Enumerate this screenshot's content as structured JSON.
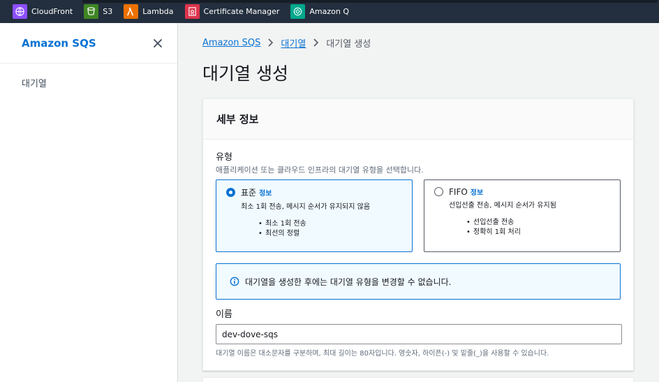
{
  "topbar": {
    "services": [
      {
        "label": "CloudFront",
        "icon": "cloudfront-icon",
        "color": "#8c4fff"
      },
      {
        "label": "S3",
        "icon": "s3-icon",
        "color": "#3f8624"
      },
      {
        "label": "Lambda",
        "icon": "lambda-icon",
        "color": "#ed7100"
      },
      {
        "label": "Certificate Manager",
        "icon": "certificate-manager-icon",
        "color": "#dd344c"
      },
      {
        "label": "Amazon Q",
        "icon": "amazon-q-icon",
        "color": "#01a88d"
      }
    ]
  },
  "sidenav": {
    "title": "Amazon SQS",
    "items": [
      {
        "label": "대기열"
      }
    ]
  },
  "breadcrumb": {
    "items": [
      {
        "label": "Amazon SQS"
      },
      {
        "label": "대기열"
      },
      {
        "label": "대기열 생성"
      }
    ]
  },
  "page": {
    "title": "대기열 생성"
  },
  "details": {
    "header": "세부 정보",
    "type_label": "유형",
    "type_desc": "애플리케이션 또는 클라우드 인프라의 대기열 유형을 선택합니다.",
    "options": [
      {
        "name": "표준",
        "info": "정보",
        "desc": "최소 1회 전송, 메시지 순서가 유지되지 않음",
        "bullets": [
          "최소 1회 전송",
          "최선의 정렬"
        ],
        "selected": true
      },
      {
        "name": "FIFO",
        "info": "정보",
        "desc": "선입선출 전송, 메시지 순서가 유지됨",
        "bullets": [
          "선입선출 전송",
          "정확히 1회 처리"
        ],
        "selected": false
      }
    ],
    "alert": "대기열을 생성한 후에는 대기열 유형을 변경할 수 없습니다.",
    "name_label": "이름",
    "name_value": "dev-dove-sqs",
    "name_constraint": "대기열 이름은 대소문자를 구분하며, 최대 길이는 80자입니다. 영숫자, 하이픈(-) 및 밑줄(_)을 사용할 수 있습니다."
  },
  "colors": {
    "accent": "#0972d3",
    "topbar": "#232f3e"
  }
}
